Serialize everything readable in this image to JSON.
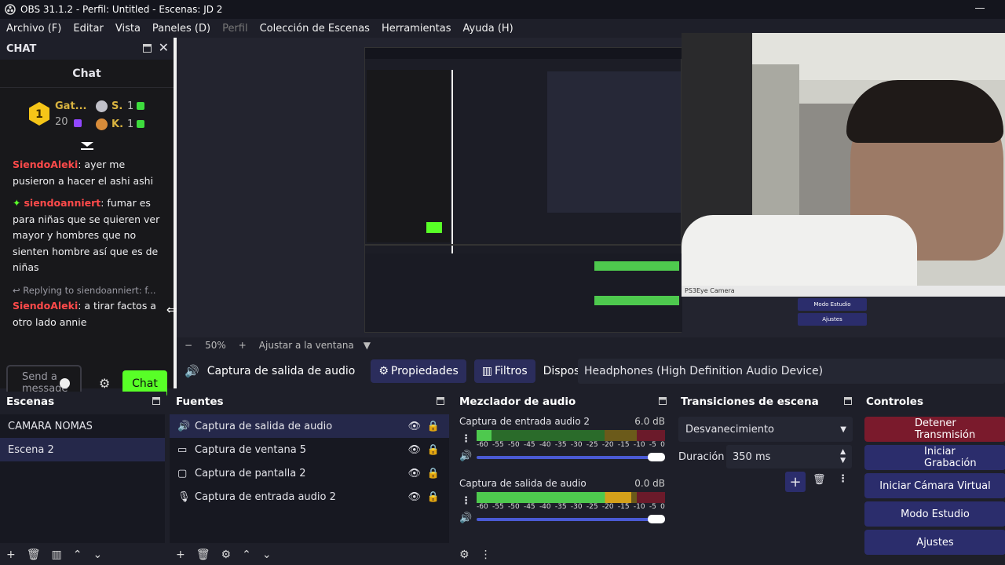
{
  "window": {
    "title": "OBS 31.1.2 - Perfil: Untitled - Escenas: JD 2"
  },
  "menu": [
    "Archivo (F)",
    "Editar",
    "Vista",
    "Paneles (D)",
    "Perfil",
    "Colección de Escenas",
    "Herramientas",
    "Ayuda (H)"
  ],
  "chat_dock": {
    "title": "CHAT",
    "panel_title": "Chat",
    "leaderboard": {
      "first_name": "Gat...",
      "first_count": "20",
      "second_name": "S.",
      "second_count": "1",
      "third_name": "K.",
      "third_count": "1",
      "rank_one": "1"
    },
    "messages": [
      {
        "user": "SiendoAleki",
        "text": ": ayer me pusieron a hacer el ashi ashi"
      },
      {
        "user": "siendoanniert",
        "text": ": fumar es para niñas que se quieren ver mayor y hombres que no sienten hombre así que es de niñas"
      },
      {
        "reply": "Replying to siendoanniert: f...",
        "user": "SiendoAleki",
        "text": ": a tirar factos a otro lado annie"
      }
    ],
    "send_placeholder": "Send a message",
    "chat_button": "Chat"
  },
  "preview": {
    "zoom_level": "50%",
    "fit_label": "Ajustar a la ventana",
    "webcam_label": "PS3Eye Camera"
  },
  "properties_bar": {
    "source_name": "Captura de salida de audio",
    "properties_label": "Propiedades",
    "filters_label": "Filtros",
    "device_label": "Dispositivo",
    "device_value": "Headphones (High Definition Audio Device)"
  },
  "scenes": {
    "title": "Escenas",
    "items": [
      "CAMARA NOMAS",
      "Escena 2"
    ],
    "selected": "Escena 2"
  },
  "sources": {
    "title": "Fuentes",
    "items": [
      {
        "name": "Captura de salida de audio",
        "icon": "speaker-icon"
      },
      {
        "name": "Captura de ventana 5",
        "icon": "window-icon"
      },
      {
        "name": "Captura de pantalla 2",
        "icon": "monitor-icon"
      },
      {
        "name": "Captura de entrada audio 2",
        "icon": "microphone-icon"
      }
    ]
  },
  "mixer": {
    "title": "Mezclador de audio",
    "channels": [
      {
        "name": "Captura de entrada audio 2",
        "db": "6.0 dB",
        "level": 0.08
      },
      {
        "name": "Captura de salida de audio",
        "db": "0.0 dB",
        "level": 0.82
      }
    ],
    "scale": [
      "-60",
      "-55",
      "-50",
      "-45",
      "-40",
      "-35",
      "-30",
      "-25",
      "-20",
      "-15",
      "-10",
      "-5",
      "0"
    ]
  },
  "transitions": {
    "title": "Transiciones de escena",
    "selected": "Desvanecimiento",
    "duration_label": "Duración",
    "duration_value": "350 ms"
  },
  "controls": {
    "title": "Controles",
    "buttons": [
      "Detener Transmisión",
      "Iniciar Grabación",
      "Iniciar Cámara Virtual",
      "Modo Estudio",
      "Ajustes"
    ]
  },
  "colors": {
    "accent": "#2b2d6c",
    "stop": "#7a1a2c",
    "chat_button": "#58ff27",
    "selected_row": "#25284a"
  }
}
